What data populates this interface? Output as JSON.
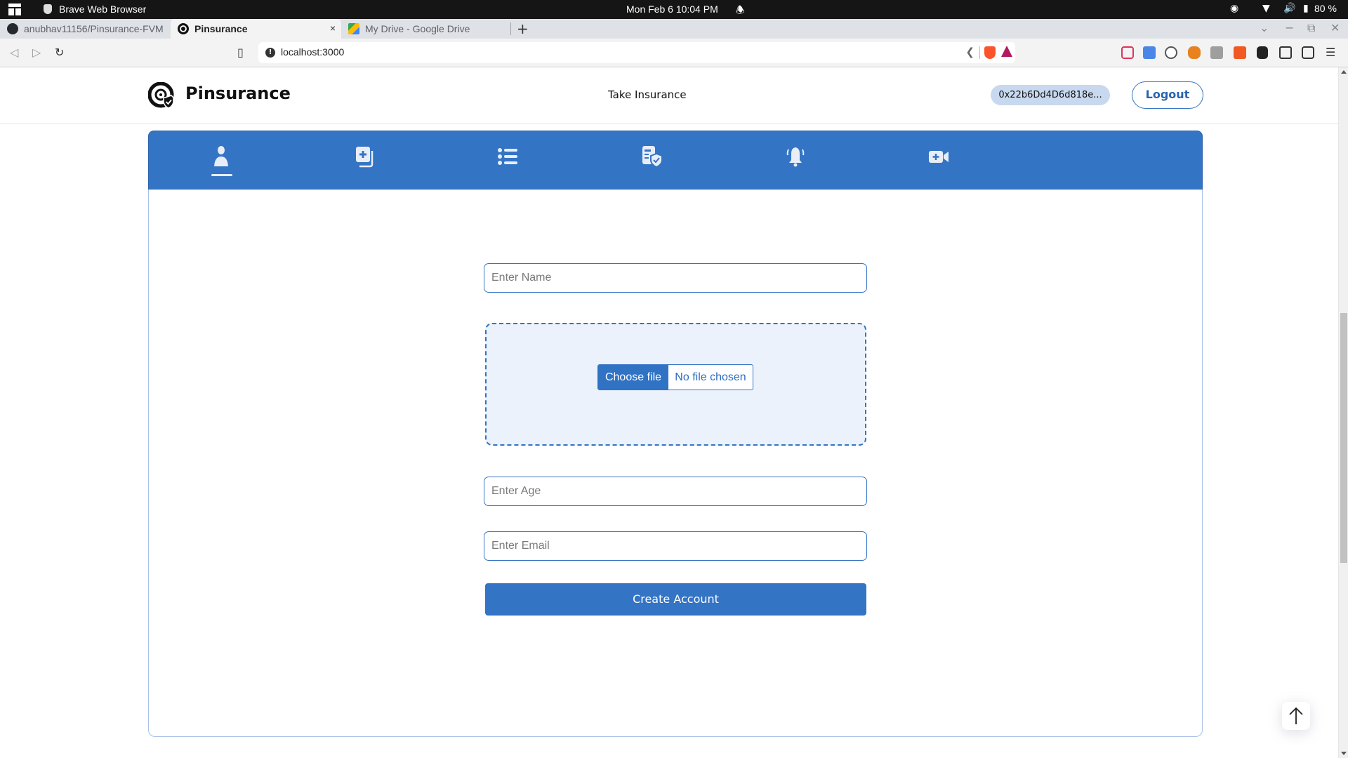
{
  "os": {
    "app_name": "Brave Web Browser",
    "clock": "Mon Feb 6  10:04 PM",
    "battery": "80 %"
  },
  "browser": {
    "tabs": [
      {
        "label": "anubhav11156/Pinsurance-FVM",
        "icon": "github-icon",
        "active": false
      },
      {
        "label": "Pinsurance",
        "icon": "pinsurance-favicon",
        "active": true
      },
      {
        "label": "My Drive - Google Drive",
        "icon": "google-drive-icon",
        "active": false
      }
    ],
    "close_glyph": "×",
    "new_tab_glyph": "+",
    "url": "localhost:3000",
    "extensions": [
      "pocket-icon",
      "google-translate-icon",
      "json-viewer-icon",
      "metamask-icon",
      "touch-icon",
      "coupon-extension-icon",
      "extensions-puzzle-icon",
      "sidebar-icon",
      "wallet-icon",
      "menu-icon"
    ]
  },
  "header": {
    "brand": "Pinsurance",
    "nav_link": "Take Insurance",
    "wallet_address": "0x22b6Dd4D6d818e...",
    "logout_label": "Logout"
  },
  "nav_tabs": [
    {
      "name": "profile",
      "icon": "user-icon",
      "active": true
    },
    {
      "name": "add-insurance",
      "icon": "medical-files-plus-icon",
      "active": false
    },
    {
      "name": "list",
      "icon": "list-icon",
      "active": false
    },
    {
      "name": "claims",
      "icon": "document-shield-check-icon",
      "active": false
    },
    {
      "name": "notifications",
      "icon": "bell-icon",
      "active": false
    },
    {
      "name": "video-consult",
      "icon": "video-plus-icon",
      "active": false
    }
  ],
  "form": {
    "name_placeholder": "Enter Name",
    "name_value": "",
    "file_button_label": "Choose file",
    "file_status": "No file chosen",
    "age_placeholder": "Enter Age",
    "age_value": "",
    "email_placeholder": "Enter Email",
    "email_value": "",
    "submit_label": "Create Account"
  },
  "colors": {
    "primary": "#3474c4",
    "chip_bg": "#c8d9ef",
    "dropzone_bg": "#ebf2fb"
  }
}
